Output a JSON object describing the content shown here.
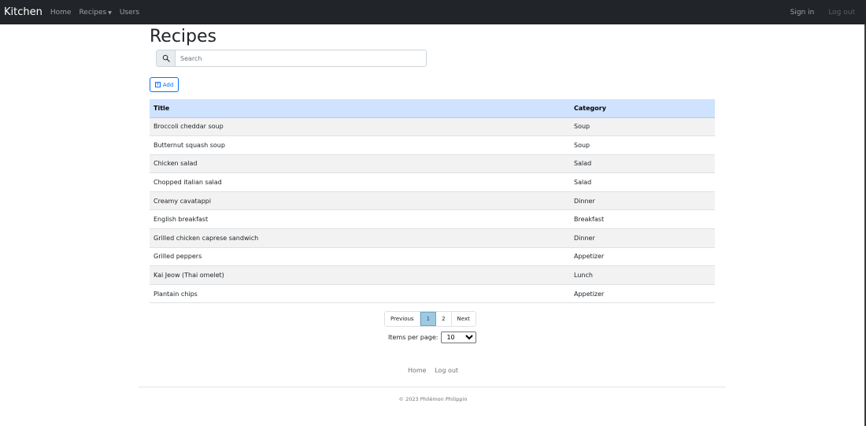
{
  "navbar": {
    "brand": "Kitchen",
    "links": [
      {
        "label": "Home"
      },
      {
        "label": "Recipes"
      },
      {
        "label": "Users"
      }
    ],
    "sign_in": "Sign in",
    "log_out": "Log out"
  },
  "main": {
    "title": "Recipes",
    "search": {
      "placeholder": "Search",
      "value": ""
    },
    "add_label": "Add"
  },
  "table": {
    "headers": [
      "Title",
      "Category"
    ],
    "rows": [
      [
        "Broccoli cheddar soup",
        "Soup"
      ],
      [
        "Butternut squash soup",
        "Soup"
      ],
      [
        "Chicken salad",
        "Salad"
      ],
      [
        "Chopped italian salad",
        "Salad"
      ],
      [
        "Creamy cavatappi",
        "Dinner"
      ],
      [
        "English breakfast",
        "Breakfast"
      ],
      [
        "Grilled chicken caprese sandwich",
        "Dinner"
      ],
      [
        "Grilled peppers",
        "Appetizer"
      ],
      [
        "Kai Jeow (Thai omelet)",
        "Lunch"
      ],
      [
        "Plantain chips",
        "Appetizer"
      ]
    ]
  },
  "pagination": {
    "previous": "Previous",
    "pages": [
      "1",
      "2"
    ],
    "active_page": "1",
    "next": "Next"
  },
  "per_page": {
    "label": "Items per page:",
    "selected": "10"
  },
  "footer": {
    "links": [
      "Home",
      "Log out"
    ],
    "copyright": "© 2023 Philémon Philippin"
  },
  "colors": {
    "navbar_bg": "#212529",
    "table_header_bg": "#cfe2ff",
    "accent": "#0d6efd",
    "active_page_bg": "#9ecae1"
  }
}
